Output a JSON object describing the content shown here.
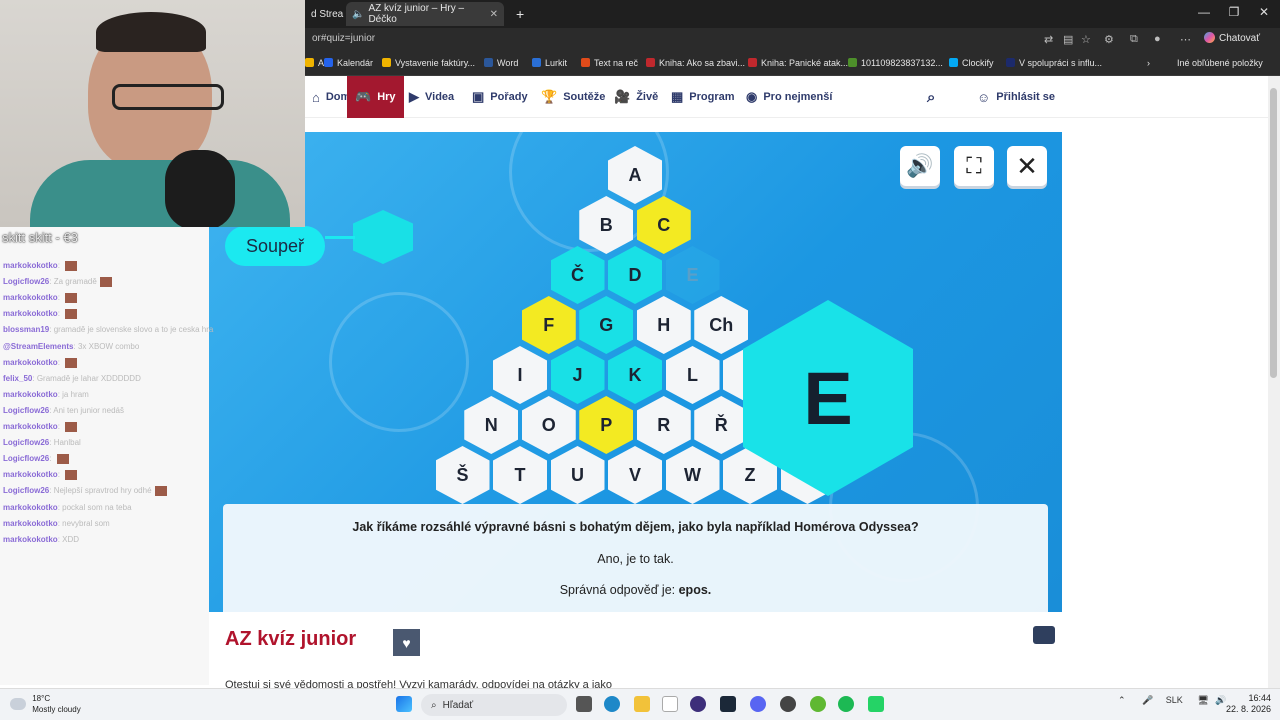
{
  "browser": {
    "tabs": [
      {
        "label": "d Strea",
        "active": false
      },
      {
        "label": "AZ kvíz junior – Hry – Déčko",
        "active": true
      }
    ],
    "new_tab": "+",
    "url": "or#quiz=junior",
    "copilot_label": "Chatovať",
    "bookmarks": [
      {
        "label": "A",
        "color": "#f0b400"
      },
      {
        "label": "Kalendár",
        "color": "#2563eb"
      },
      {
        "label": "Vystavenie faktúry...",
        "color": "#f0b400"
      },
      {
        "label": "Word",
        "color": "#2b579a"
      },
      {
        "label": "Lurkit",
        "color": "#2a6fd6"
      },
      {
        "label": "Text na reč",
        "color": "#e04b1a"
      },
      {
        "label": "Kniha: Ako sa zbavi...",
        "color": "#c0282d"
      },
      {
        "label": "Kniha: Panické atak...",
        "color": "#c0282d"
      },
      {
        "label": "101109823837132...",
        "color": "#4d8f2a"
      },
      {
        "label": "Clockify",
        "color": "#03a9f4"
      },
      {
        "label": "V spolupráci s influ...",
        "color": "#1c2a6b"
      }
    ],
    "other_bookmarks": "Iné obľúbené položky"
  },
  "site_nav": {
    "items": [
      {
        "label": "Domů",
        "icon": "home-icon",
        "active": false
      },
      {
        "label": "Hry",
        "icon": "gamepad-icon",
        "active": true
      },
      {
        "label": "Videa",
        "icon": "play-icon",
        "active": false
      },
      {
        "label": "Pořady",
        "icon": "tv-icon",
        "active": false
      },
      {
        "label": "Soutěže",
        "icon": "trophy-icon",
        "active": false
      },
      {
        "label": "Živě",
        "icon": "camera-icon",
        "active": false
      },
      {
        "label": "Program",
        "icon": "grid-icon",
        "active": false
      },
      {
        "label": "Pro nejmenší",
        "icon": "bear-icon",
        "active": false
      }
    ],
    "login_label": "Přihlásit se"
  },
  "game": {
    "opponent_label": "Soupeř",
    "selected_letter": "E",
    "rows": [
      [
        {
          "l": "A",
          "s": "white"
        }
      ],
      [
        {
          "l": "B",
          "s": "white"
        },
        {
          "l": "C",
          "s": "yellow"
        }
      ],
      [
        {
          "l": "Č",
          "s": "cyan"
        },
        {
          "l": "D",
          "s": "cyan"
        },
        {
          "l": "E",
          "s": "dim"
        }
      ],
      [
        {
          "l": "F",
          "s": "yellow"
        },
        {
          "l": "G",
          "s": "cyan"
        },
        {
          "l": "H",
          "s": "white"
        },
        {
          "l": "Ch",
          "s": "white"
        }
      ],
      [
        {
          "l": "I",
          "s": "white"
        },
        {
          "l": "J",
          "s": "cyan"
        },
        {
          "l": "K",
          "s": "cyan"
        },
        {
          "l": "L",
          "s": "white"
        },
        {
          "l": "",
          "s": "white"
        }
      ],
      [
        {
          "l": "N",
          "s": "white"
        },
        {
          "l": "O",
          "s": "white"
        },
        {
          "l": "P",
          "s": "yellow"
        },
        {
          "l": "R",
          "s": "white"
        },
        {
          "l": "Ř",
          "s": "white"
        },
        {
          "l": "",
          "s": "white"
        }
      ],
      [
        {
          "l": "Š",
          "s": "white"
        },
        {
          "l": "T",
          "s": "white"
        },
        {
          "l": "U",
          "s": "white"
        },
        {
          "l": "V",
          "s": "white"
        },
        {
          "l": "W",
          "s": "white"
        },
        {
          "l": "Z",
          "s": "white"
        },
        {
          "l": "",
          "s": "white"
        }
      ]
    ],
    "question": "Jak říkáme rozsáhlé výpravné básni s bohatým dějem, jako byla například Homérova Odyssea?",
    "feedback": "Ano, je to tak.",
    "answer_prefix": "Správná odpověď je:",
    "answer": "epos."
  },
  "page": {
    "title": "AZ kvíz junior",
    "description": "Otestuj si své vědomosti a postřeh! Vyzvi kamarády, odpovídej na otázky a jako"
  },
  "stream": {
    "chat_title": "skitt skitt  - €3",
    "messages": [
      {
        "user": "markokokotko",
        "text": "",
        "emote": true
      },
      {
        "user": "Logicflow26",
        "text": "Za gramadě",
        "emote": true
      },
      {
        "user": "markokokotko",
        "text": "",
        "emote": true
      },
      {
        "user": "markokokotko",
        "text": "",
        "emote": true
      },
      {
        "user": "blossman19",
        "text": "gramadě je slovenske slovo a to je ceska hra",
        "emote": false
      },
      {
        "user": "@StreamElements",
        "text": "3x XBOW combo",
        "emote": false
      },
      {
        "user": "markokokotko",
        "text": "",
        "emote": true
      },
      {
        "user": "felix_50",
        "text": "Gramadě je lahar XDDDDDD",
        "emote": false
      },
      {
        "user": "markokokotko",
        "text": "ja hram",
        "emote": false
      },
      {
        "user": "Logicflow26",
        "text": "Ani ten junior nedáš",
        "emote": false
      },
      {
        "user": "markokokotko",
        "text": "",
        "emote": true
      },
      {
        "user": "Logicflow26",
        "text": "Hanlbal",
        "emote": false
      },
      {
        "user": "Logicflow26",
        "text": "",
        "emote": true
      },
      {
        "user": "markokokotko",
        "text": "",
        "emote": true
      },
      {
        "user": "Logicflow26",
        "text": "Nejlepší spravtrod hry odhé",
        "emote": true
      },
      {
        "user": "markokokotko",
        "text": "pockal som na teba",
        "emote": false
      },
      {
        "user": "markokokotko",
        "text": "nevybral som",
        "emote": false
      },
      {
        "user": "markokokotko",
        "text": "XDD",
        "emote": false
      }
    ]
  },
  "taskbar": {
    "weather_temp": "18°C",
    "weather_desc": "Mostly cloudy",
    "search_label": "Hľadať",
    "lang": "SLK",
    "time": "16:44",
    "date": "22. 8. 2026"
  }
}
